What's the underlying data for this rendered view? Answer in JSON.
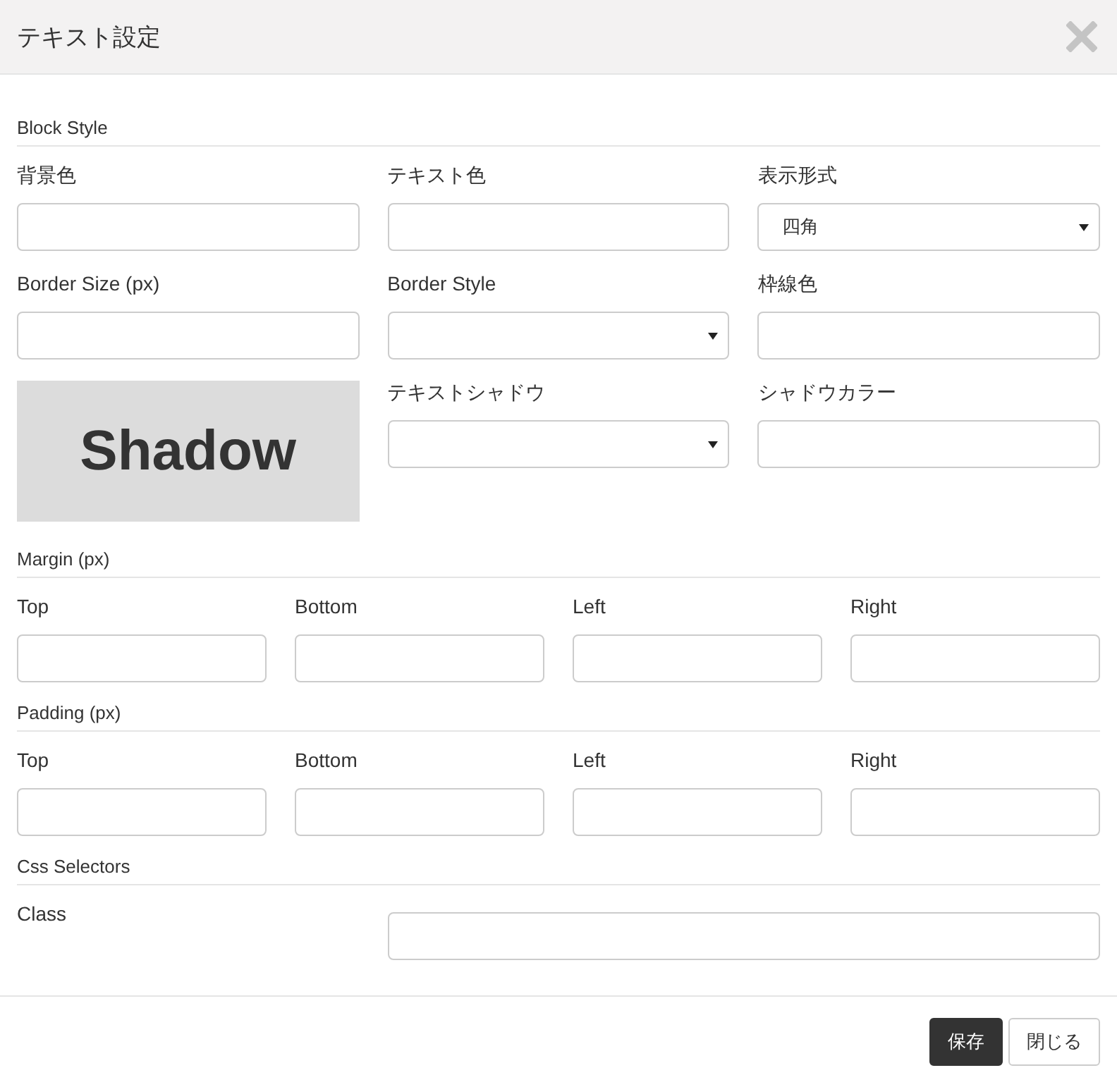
{
  "dialog": {
    "title": "テキスト設定"
  },
  "sections": [
    {
      "title": "Block Style",
      "fields": [
        {
          "kind": "input",
          "label": "背景色"
        },
        {
          "kind": "input",
          "label": "テキスト色"
        },
        {
          "kind": "select",
          "label": "表示形式",
          "value": "四角"
        },
        {
          "kind": "input",
          "label": "Border Size (px)"
        },
        {
          "kind": "select",
          "label": "Border Style"
        },
        {
          "kind": "input",
          "label": "枠線色"
        },
        {
          "kind": "preview",
          "text": "Shadow"
        },
        {
          "kind": "select",
          "label": "テキストシャドウ"
        },
        {
          "kind": "input",
          "label": "シャドウカラー"
        }
      ]
    },
    {
      "title": "Margin (px)",
      "fields": [
        {
          "kind": "input",
          "label": "Top"
        },
        {
          "kind": "input",
          "label": "Bottom"
        },
        {
          "kind": "input",
          "label": "Left"
        },
        {
          "kind": "input",
          "label": "Right"
        }
      ]
    },
    {
      "title": "Padding (px)",
      "fields": [
        {
          "kind": "input",
          "label": "Top"
        },
        {
          "kind": "input",
          "label": "Bottom"
        },
        {
          "kind": "input",
          "label": "Left"
        },
        {
          "kind": "input",
          "label": "Right"
        }
      ]
    },
    {
      "title": "Css Selectors",
      "fields": [
        {
          "kind": "wide-input",
          "label": "Class"
        }
      ]
    }
  ],
  "buttons": [
    {
      "label": "保存",
      "kind": "primary"
    },
    {
      "label": "閉じる",
      "kind": "default"
    }
  ]
}
